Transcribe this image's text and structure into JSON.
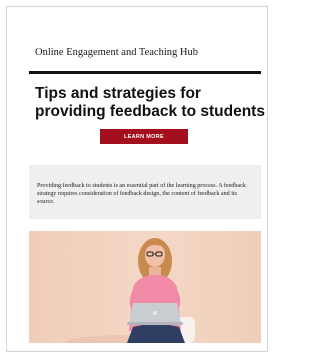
{
  "header": {
    "site_name": "Online Engagement and Teaching Hub"
  },
  "article": {
    "title": "Tips and strategies for providing feedback to students",
    "cta_label": "LEARN MORE"
  },
  "intro": {
    "text": "Providing feedback to students is an essential part of the learning process. A feedback strategy requires consideration of feedback design, the content of feedback and its source."
  },
  "image": {
    "subject": "woman-with-laptop-photo"
  },
  "colors": {
    "accent": "#a30f1d",
    "intro_background": "#efefef",
    "photo_background": "#f2d2bf"
  }
}
